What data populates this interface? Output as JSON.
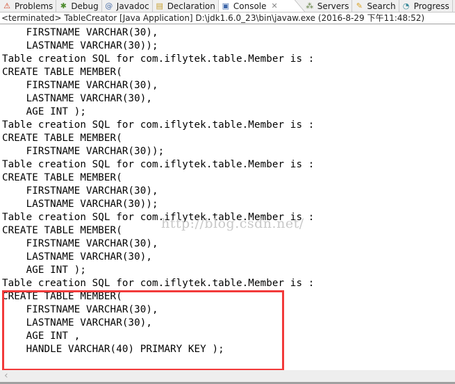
{
  "tabs": [
    {
      "label": "Problems",
      "icon": "problems-icon",
      "glyph": "⚠",
      "color": "#d04020",
      "active": false
    },
    {
      "label": "Debug",
      "icon": "debug-bug-icon",
      "glyph": "✱",
      "color": "#4c8a2c",
      "active": false
    },
    {
      "label": "Javadoc",
      "icon": "javadoc-at-icon",
      "glyph": "@",
      "color": "#4a6fa8",
      "active": false
    },
    {
      "label": "Declaration",
      "icon": "declaration-icon",
      "glyph": "▤",
      "color": "#c8a030",
      "active": false
    },
    {
      "label": "Console",
      "icon": "console-monitor-icon",
      "glyph": "▣",
      "color": "#3a64a8",
      "active": true,
      "close": "✕"
    },
    {
      "label": "Servers",
      "icon": "servers-icon",
      "glyph": "⁂",
      "color": "#5a7a3a",
      "active": false
    },
    {
      "label": "Search",
      "icon": "search-flashlight-icon",
      "glyph": "✎",
      "color": "#d8a020",
      "active": false
    },
    {
      "label": "Progress",
      "icon": "progress-icon",
      "glyph": "◔",
      "color": "#3a8a9a",
      "active": false
    }
  ],
  "status": "<terminated> TableCreator [Java Application] D:\\jdk1.6.0_23\\bin\\javaw.exe (2016-8-29 下午11:48:52)",
  "console_lines": [
    "    FIRSTNAME VARCHAR(30),",
    "    LASTNAME VARCHAR(30));",
    "Table creation SQL for com.iflytek.table.Member is :",
    "CREATE TABLE MEMBER(",
    "    FIRSTNAME VARCHAR(30),",
    "    LASTNAME VARCHAR(30),",
    "    AGE INT );",
    "Table creation SQL for com.iflytek.table.Member is :",
    "CREATE TABLE MEMBER(",
    "    FIRSTNAME VARCHAR(30));",
    "Table creation SQL for com.iflytek.table.Member is :",
    "CREATE TABLE MEMBER(",
    "    FIRSTNAME VARCHAR(30),",
    "    LASTNAME VARCHAR(30));",
    "Table creation SQL for com.iflytek.table.Member is :",
    "CREATE TABLE MEMBER(",
    "    FIRSTNAME VARCHAR(30),",
    "    LASTNAME VARCHAR(30),",
    "    AGE INT );",
    "Table creation SQL for com.iflytek.table.Member is :",
    "CREATE TABLE MEMBER(",
    "    FIRSTNAME VARCHAR(30),",
    "    LASTNAME VARCHAR(30),",
    "    AGE INT ,",
    "    HANDLE VARCHAR(40) PRIMARY KEY );"
  ],
  "watermark": "http://blog.csdn.net/",
  "highlight_color": "#f23a3a",
  "scroll_left_arrow": "‹"
}
